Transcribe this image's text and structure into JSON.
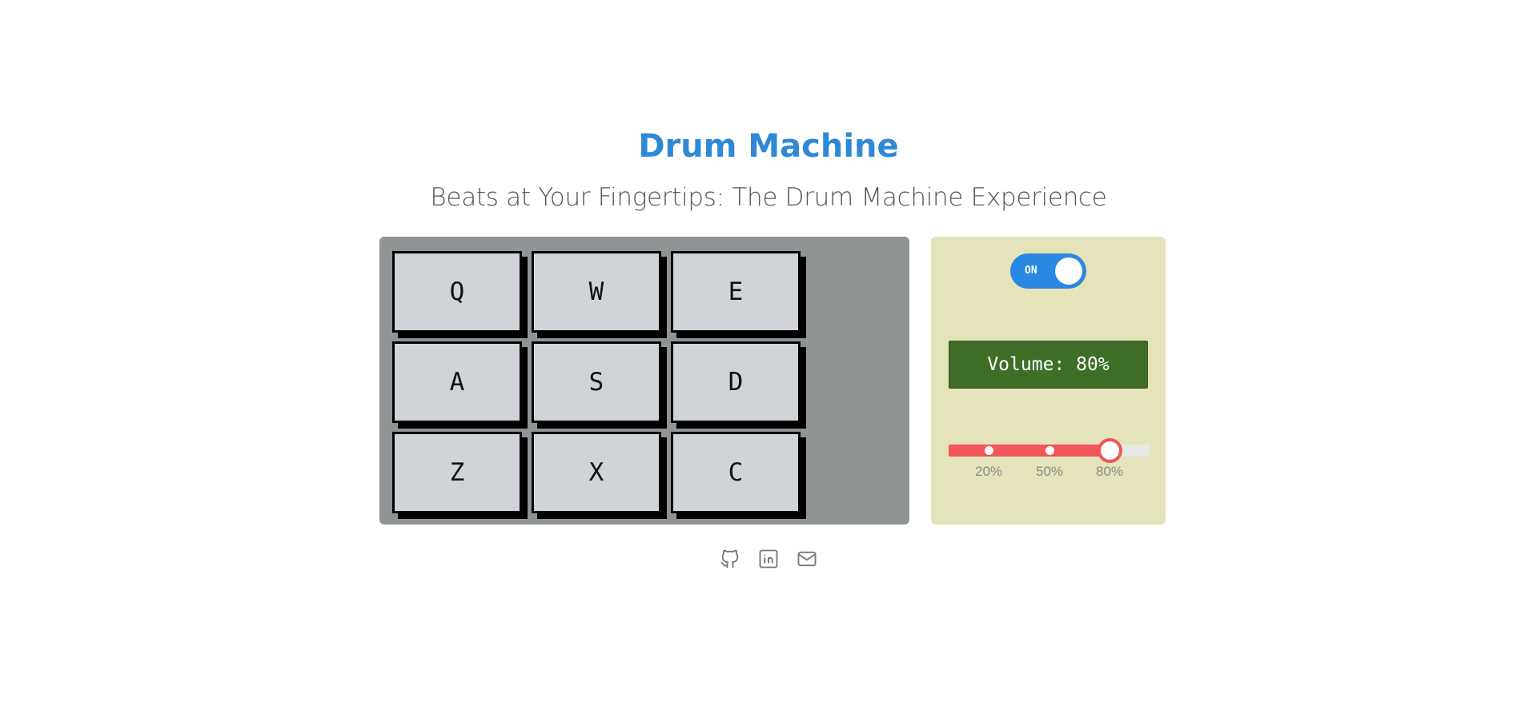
{
  "header": {
    "title": "Drum Machine",
    "subtitle": "Beats at Your Fingertips: The Drum Machine Experience"
  },
  "pads": [
    {
      "key": "Q"
    },
    {
      "key": "W"
    },
    {
      "key": "E"
    },
    {
      "key": "A"
    },
    {
      "key": "S"
    },
    {
      "key": "D"
    },
    {
      "key": "Z"
    },
    {
      "key": "X"
    },
    {
      "key": "C"
    }
  ],
  "controls": {
    "power": {
      "label": "ON",
      "state": "on"
    },
    "display": "Volume: 80%",
    "volume": {
      "value": 80,
      "marks": [
        {
          "value": 20,
          "label": "20%"
        },
        {
          "value": 50,
          "label": "50%"
        },
        {
          "value": 80,
          "label": "80%"
        }
      ]
    }
  },
  "footer": {
    "links": [
      {
        "icon": "github-icon"
      },
      {
        "icon": "linkedin-icon"
      },
      {
        "icon": "mail-icon"
      }
    ]
  },
  "colors": {
    "title": "#2f88d6",
    "pad_bank_bg": "#909495",
    "pad_bg": "#d0d3d8",
    "controls_bg": "#e4e3b9",
    "toggle_on": "#2a88e2",
    "display_bg": "#3f6e26",
    "slider_fill": "#f15658"
  }
}
